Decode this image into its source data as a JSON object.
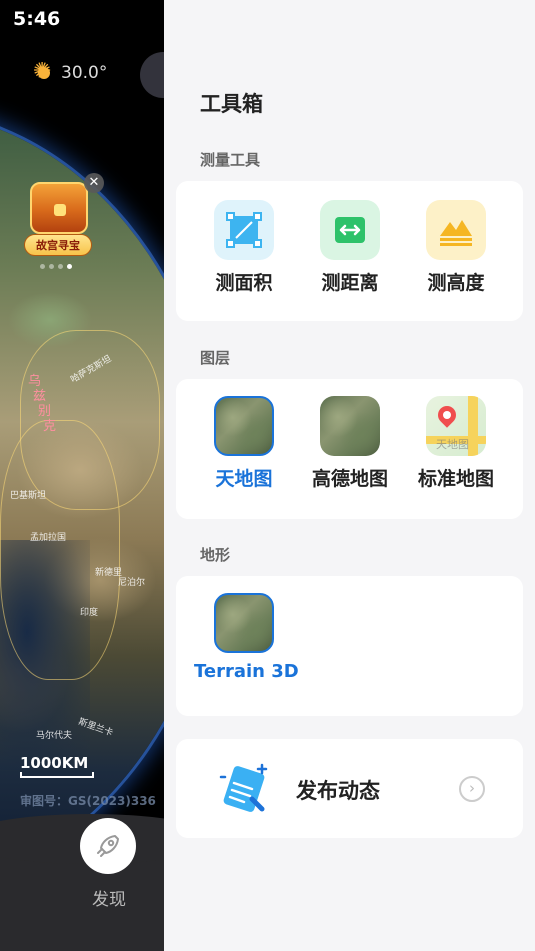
{
  "status": {
    "time": "5:46"
  },
  "weather": {
    "temperature": "30.0°",
    "icon": "sun-icon"
  },
  "promo": {
    "label": "故宫寻宝",
    "close_glyph": "✕"
  },
  "map": {
    "labels": [
      {
        "text": "哈萨克斯坦",
        "color": "white"
      },
      {
        "text": "乌",
        "color": "pink"
      },
      {
        "text": "兹",
        "color": "pink"
      },
      {
        "text": "别",
        "color": "pink"
      },
      {
        "text": "克",
        "color": "pink"
      },
      {
        "text": "巴基斯坦",
        "color": "white"
      },
      {
        "text": "印度",
        "color": "white"
      },
      {
        "text": "尼泊尔",
        "color": "white"
      },
      {
        "text": "斯里兰卡",
        "color": "white"
      },
      {
        "text": "马尔代夫",
        "color": "white"
      },
      {
        "text": "新德里",
        "color": "white"
      },
      {
        "text": "孟加拉国",
        "color": "white"
      }
    ],
    "scale": "1000KM",
    "approval": "审图号：GS(2023)336"
  },
  "bottom_nav": {
    "discover_label": "发现"
  },
  "toolbox": {
    "title": "工具箱",
    "measure": {
      "title": "测量工具",
      "tools": [
        {
          "label": "测面积",
          "icon": "area-measure-icon",
          "color": "#3db4f0"
        },
        {
          "label": "测距离",
          "icon": "distance-measure-icon",
          "color": "#2ec26a"
        },
        {
          "label": "测高度",
          "icon": "height-measure-icon",
          "color": "#f5b623"
        }
      ]
    },
    "layers": {
      "title": "图层",
      "items": [
        {
          "label": "天地图",
          "selected": true
        },
        {
          "label": "高德地图",
          "selected": false
        },
        {
          "label": "标准地图",
          "selected": false,
          "watermark": "天地图"
        }
      ]
    },
    "terrain": {
      "title": "地形",
      "items": [
        {
          "label": "Terrain 3D",
          "selected": true
        }
      ]
    },
    "publish": {
      "label": "发布动态",
      "arrow": "›"
    }
  }
}
